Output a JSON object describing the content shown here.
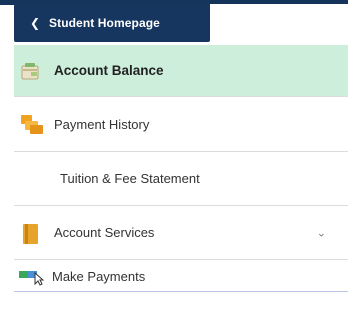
{
  "header": {
    "back_icon": "chevron-left-icon",
    "back_label": "Student Homepage",
    "bar_color": "#16365f"
  },
  "nav": {
    "items": [
      {
        "label": "Account Balance",
        "icon": "wallet-icon",
        "selected": true,
        "highlight_color": "#cdeedb"
      },
      {
        "label": "Payment History",
        "icon": "bills-icon"
      },
      {
        "label": "Tuition & Fee Statement",
        "icon": null
      },
      {
        "label": "Account Services",
        "icon": "folder-icon",
        "expandable": true,
        "expand_icon": "chevron-down-icon"
      },
      {
        "label": "Make Payments",
        "icon": "payment-cursor-icon"
      }
    ]
  }
}
